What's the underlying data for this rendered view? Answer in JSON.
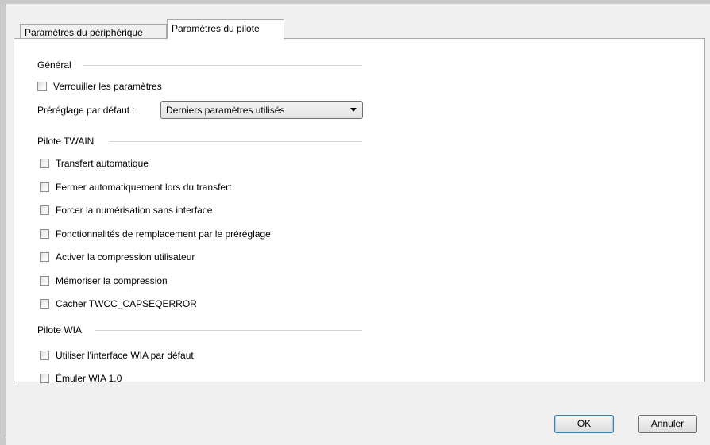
{
  "tabs": {
    "device_settings": "Paramètres du périphérique",
    "driver_settings": "Paramètres du pilote"
  },
  "general": {
    "title": "Général",
    "lock_settings": "Verrouiller les paramètres",
    "default_preset_label": "Préréglage par défaut :",
    "default_preset_value": "Derniers paramètres utilisés"
  },
  "twain": {
    "title": "Pilote TWAIN",
    "options": [
      "Transfert automatique",
      "Fermer automatiquement lors du transfert",
      "Forcer la numérisation sans interface",
      "Fonctionnalités de remplacement par le préréglage",
      "Activer la compression utilisateur",
      "Mémoriser la compression",
      "Cacher TWCC_CAPSEQERROR"
    ]
  },
  "wia": {
    "title": "Pilote WIA",
    "options": [
      "Utiliser l'interface WIA par défaut",
      "Émuler WIA 1.0"
    ]
  },
  "buttons": {
    "ok": "OK",
    "cancel": "Annuler"
  }
}
